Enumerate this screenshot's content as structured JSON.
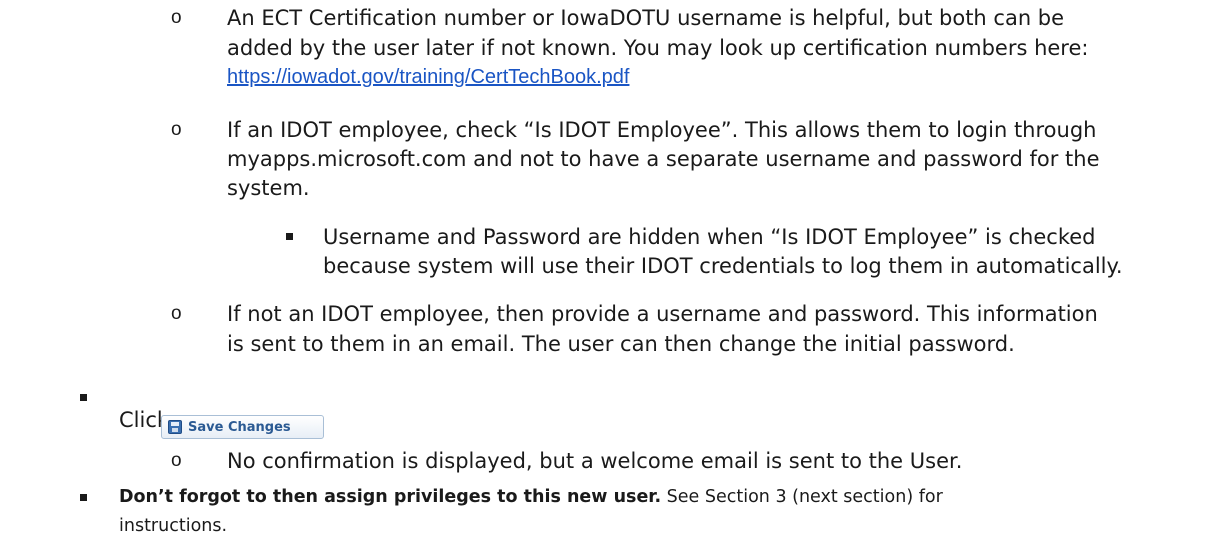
{
  "items": {
    "ect_line1": "An ECT Certification number or IowaDOTU username is helpful, but both can be",
    "ect_line2": "added by the user later if not known.  You may look up certification numbers here:",
    "ect_link": "https://iowadot.gov/training/CertTechBook.pdf",
    "idot_line1": "If an IDOT employee, check “Is IDOT Employee”. This allows them to login through",
    "idot_line2": "myapps.microsoft.com and not to have a separate username and password for the",
    "idot_line3": "system.",
    "hidden_line1": "Username and Password are hidden when “Is IDOT Employee” is checked",
    "hidden_line2": "because system will use their IDOT credentials to log them in automatically.",
    "notidot_line1": "If not an IDOT employee, then provide a username and password.  This information",
    "notidot_line2": "is sent to them in an email.  The user can then change the initial password.",
    "click_label": "Click",
    "save_button_label": "Save Changes",
    "no_confirm": "No confirmation is displayed, but a welcome email is sent to the User.",
    "assign_bold": "Don’t forgot to then assign privileges to this new user.",
    "assign_rest": "  See Section 3 (next section) for",
    "assign_line2": "instructions."
  },
  "bullets": {
    "circle": "o"
  }
}
